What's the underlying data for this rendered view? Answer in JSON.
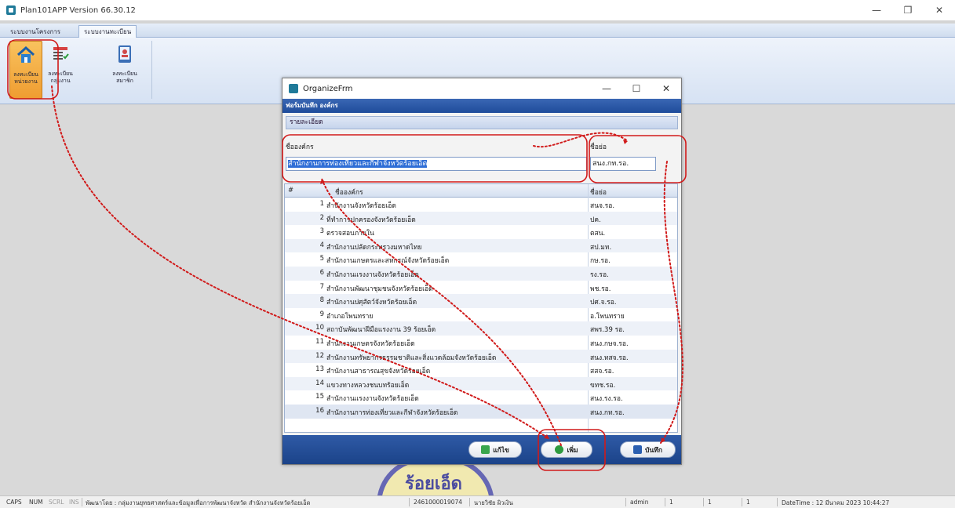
{
  "app": {
    "title": "Plan101APP Version 66.30.12",
    "tabs": [
      "ระบบงานโครงการ",
      "ระบบงานทะเบียน"
    ],
    "ribbon_buttons": [
      {
        "line1": "ลงทะเบียน",
        "line2": "หน่วยงาน"
      },
      {
        "line1": "ลงทะเบียน",
        "line2": "กลุ่มงาน"
      },
      {
        "line1": "ลงทะเบียน",
        "line2": "สมาชิก"
      }
    ],
    "window_controls": {
      "minimize": "—",
      "maximize": "❐",
      "close": "✕"
    }
  },
  "dialog": {
    "title": "OrganizeFrm",
    "controls": {
      "minimize": "—",
      "maximize": "☐",
      "close": "✕"
    },
    "form_header": "ฟอร์มบันทึก องค์กร",
    "group_header": "รายละเอียด",
    "org_name_label": "ชื่อองค์กร",
    "org_name_value": "สำนักงานการท่องเที่ยวและกีฬาจังหวัดร้อยเอ็ด",
    "abbr_label": "ชื่อย่อ",
    "abbr_value": "สนง.กท.รอ.",
    "grid": {
      "columns": [
        "#",
        "ชื่อองค์กร",
        "ชื่อย่อ"
      ],
      "rows": [
        {
          "num": "1",
          "name": "สำนักงานจังหวัดร้อยเอ็ด",
          "abbr": "สนจ.รอ."
        },
        {
          "num": "2",
          "name": "ที่ทำการปกครองจังหวัดร้อยเอ็ด",
          "abbr": "ปค."
        },
        {
          "num": "3",
          "name": "ตรวจสอบภายใน",
          "abbr": "ตสน."
        },
        {
          "num": "4",
          "name": "สำนักงานปลัดกระทรวงมหาดไทย",
          "abbr": "สป.มท."
        },
        {
          "num": "5",
          "name": "สำนักงานเกษตรและสหกรณ์จังหวัดร้อยเอ็ด",
          "abbr": "กษ.รอ."
        },
        {
          "num": "6",
          "name": "สำนักงานแรงงานจังหวัดร้อยเอ็ด",
          "abbr": "รง.รอ."
        },
        {
          "num": "7",
          "name": "สำนักงานพัฒนาชุมชนจังหวัดร้อยเอ็ด",
          "abbr": "พช.รอ."
        },
        {
          "num": "8",
          "name": "สำนักงานปศุสัตว์จังหวัดร้อยเอ็ด",
          "abbr": "ปศ.จ.รอ."
        },
        {
          "num": "9",
          "name": "อำเภอโพนทราย",
          "abbr": "อ.โพนทราย"
        },
        {
          "num": "10",
          "name": "สถาบันพัฒนาฝีมือแรงงาน 39 ร้อยเอ็ด",
          "abbr": "สพร.39 รอ."
        },
        {
          "num": "11",
          "name": "สำนักงานเกษตรจังหวัดร้อยเอ็ด",
          "abbr": "สนง.กษจ.รอ."
        },
        {
          "num": "12",
          "name": "สำนักงานทรัพยากรธรรมชาติและสิ่งแวดล้อมจังหวัดร้อยเอ็ด",
          "abbr": "สนง.ทสจ.รอ."
        },
        {
          "num": "13",
          "name": "สำนักงานสาธารณสุขจังหวัดร้อยเอ็ด",
          "abbr": "สสจ.รอ."
        },
        {
          "num": "14",
          "name": "แขวงทางหลวงชนบทร้อยเอ็ด",
          "abbr": "ขทช.รอ."
        },
        {
          "num": "15",
          "name": "สำนักงานแรงงานจังหวัดร้อยเอ็ด",
          "abbr": "สนง.รง.รอ."
        },
        {
          "num": "16",
          "name": "สำนักงานการท่องเที่ยวและกีฬาจังหวัดร้อยเอ็ด",
          "abbr": "สนง.กท.รอ."
        }
      ]
    },
    "buttons": {
      "edit": "แก้ไข",
      "add": "เพิ่ม",
      "save": "บันทึก"
    }
  },
  "statusbar": {
    "caps": "CAPS",
    "num": "NUM",
    "scrl": "SCRL",
    "ins": "INS",
    "developer": "พัฒนาโดย : กลุ่มงานยุทธศาสตร์และข้อมูลเพื่อการพัฒนาจังหวัด สำนักงานจังหวัดร้อยเอ็ด",
    "id": "2461000019074",
    "user_name": "นายวิชัย ผิวเงิน",
    "role": "admin",
    "f1": "1",
    "f2": "1",
    "f3": "1",
    "datetime": "DateTime : 12 มีนาคม 2023  10:44:27"
  },
  "colors": {
    "accent": "#1f4c9b",
    "annotation": "#d11a1a",
    "ribbon_active": "#ef9d31"
  }
}
